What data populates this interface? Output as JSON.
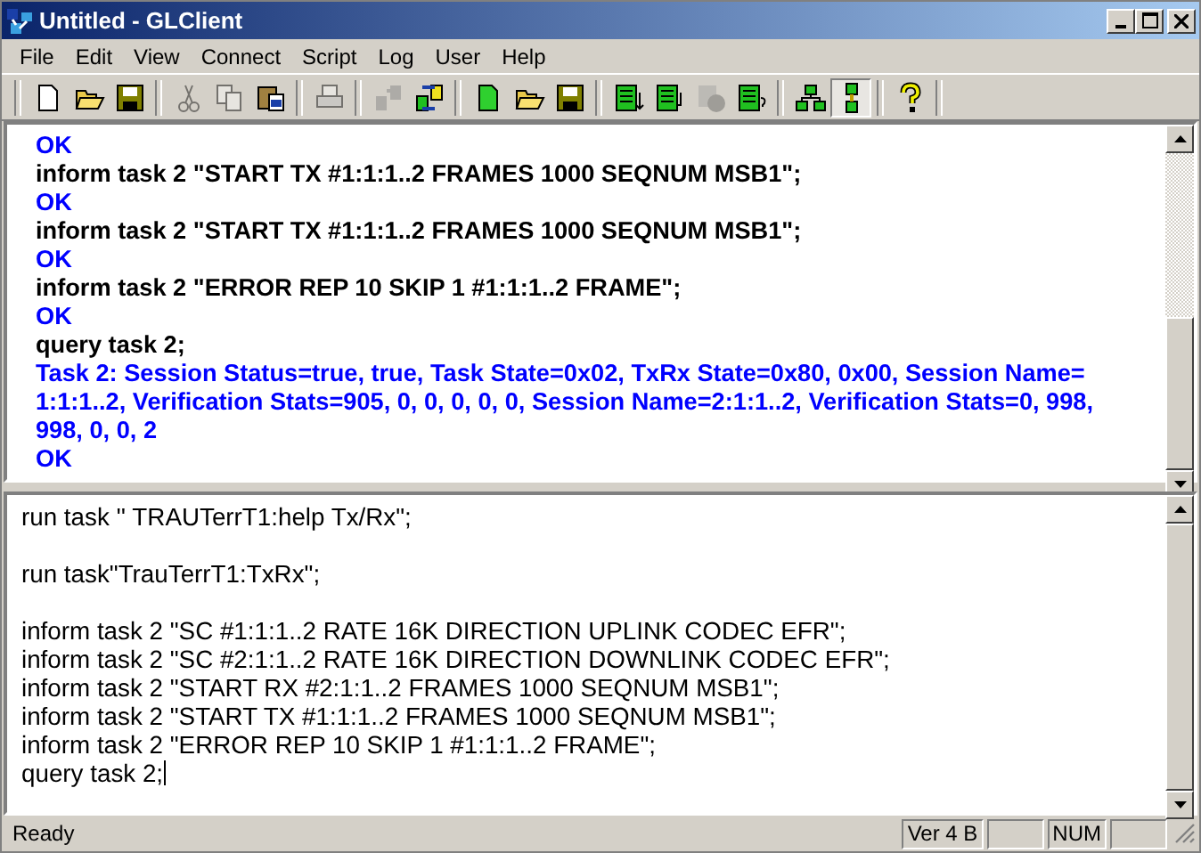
{
  "window": {
    "title": "Untitled - GLClient"
  },
  "menu": [
    {
      "label": "File"
    },
    {
      "label": "Edit"
    },
    {
      "label": "View"
    },
    {
      "label": "Connect"
    },
    {
      "label": "Script"
    },
    {
      "label": "Log"
    },
    {
      "label": "User"
    },
    {
      "label": "Help"
    }
  ],
  "toolbar": [
    [
      {
        "kind": "new",
        "disabled": false,
        "pressed": false
      },
      {
        "kind": "open",
        "disabled": false,
        "pressed": false
      },
      {
        "kind": "save",
        "disabled": false,
        "pressed": false
      }
    ],
    [
      {
        "kind": "cut",
        "disabled": true,
        "pressed": false
      },
      {
        "kind": "copy",
        "disabled": true,
        "pressed": false
      },
      {
        "kind": "paste",
        "disabled": false,
        "pressed": false
      }
    ],
    [
      {
        "kind": "print",
        "disabled": true,
        "pressed": false
      }
    ],
    [
      {
        "kind": "disconnect",
        "disabled": true,
        "pressed": false
      },
      {
        "kind": "connect",
        "disabled": false,
        "pressed": false
      }
    ],
    [
      {
        "kind": "new",
        "disabled": false,
        "pressed": false,
        "green": true
      },
      {
        "kind": "open",
        "disabled": false,
        "pressed": false
      },
      {
        "kind": "save",
        "disabled": false,
        "pressed": false
      }
    ],
    [
      {
        "kind": "run",
        "disabled": false,
        "pressed": false
      },
      {
        "kind": "step",
        "disabled": false,
        "pressed": false
      },
      {
        "kind": "stop",
        "disabled": true,
        "pressed": false
      },
      {
        "kind": "query",
        "disabled": false,
        "pressed": false
      }
    ],
    [
      {
        "kind": "tree",
        "disabled": false,
        "pressed": false
      },
      {
        "kind": "split",
        "disabled": false,
        "pressed": true
      }
    ],
    [
      {
        "kind": "help",
        "disabled": false,
        "pressed": false
      }
    ]
  ],
  "log": [
    {
      "kind": "response",
      "text": "OK"
    },
    {
      "kind": "command",
      "text": "inform task 2 \"START TX #1:1:1..2 FRAMES 1000 SEQNUM MSB1\";"
    },
    {
      "kind": "response",
      "text": "OK"
    },
    {
      "kind": "command",
      "text": "inform task 2 \"START TX #1:1:1..2 FRAMES 1000 SEQNUM MSB1\";"
    },
    {
      "kind": "response",
      "text": "OK"
    },
    {
      "kind": "command",
      "text": "inform task 2 \"ERROR REP 10 SKIP 1 #1:1:1..2 FRAME\";"
    },
    {
      "kind": "response",
      "text": "OK"
    },
    {
      "kind": "command",
      "text": "query task 2;"
    },
    {
      "kind": "response",
      "text": "Task 2: Session Status=true, true, Task State=0x02, TxRx State=0x80, 0x00, Session Name= 1:1:1..2, Verification Stats=905, 0, 0, 0, 0, 0, Session Name=2:1:1..2, Verification Stats=0, 998, 998, 0, 0, 2"
    },
    {
      "kind": "response",
      "text": "OK"
    }
  ],
  "editor": {
    "blocks": [
      [
        "run task '' TRAUTerrT1:help Tx/Rx\";"
      ],
      [
        "run task\"TrauTerrT1:TxRx\";"
      ],
      [
        "inform task 2 \"SC #1:1:1..2 RATE 16K DIRECTION UPLINK CODEC EFR\";",
        "inform task 2 \"SC #2:1:1..2 RATE 16K DIRECTION DOWNLINK CODEC EFR\";",
        "inform task 2 \"START RX #2:1:1..2 FRAMES 1000 SEQNUM MSB1\";",
        "inform task 2 \"START TX #1:1:1..2 FRAMES 1000 SEQNUM MSB1\";",
        "inform task 2 \"ERROR REP 10 SKIP 1 #1:1:1..2 FRAME\";",
        "query task 2;"
      ]
    ]
  },
  "status_bar": {
    "message": "Ready",
    "version": "Ver 4 B",
    "num": "NUM"
  }
}
